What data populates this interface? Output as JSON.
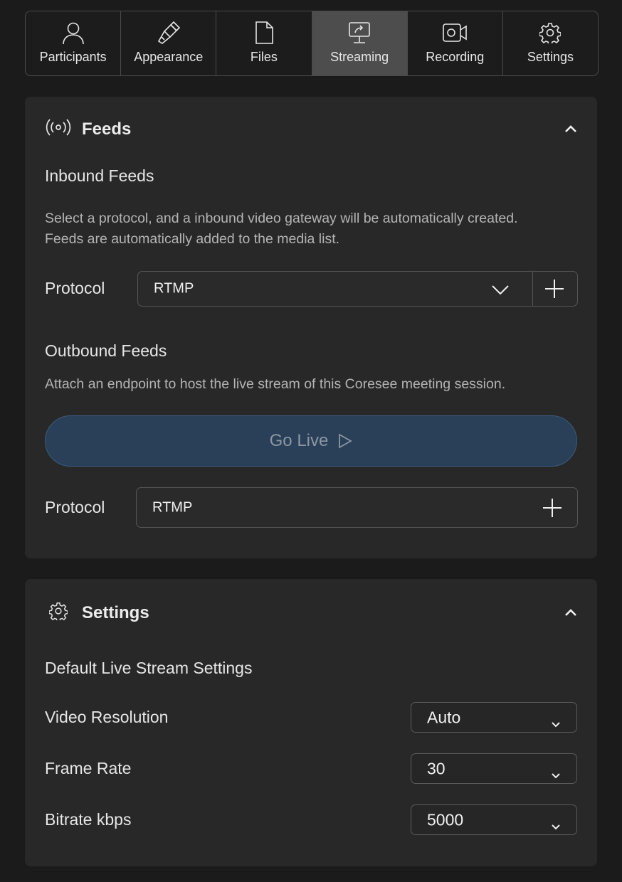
{
  "tabs": [
    {
      "label": "Participants",
      "icon": "user-icon"
    },
    {
      "label": "Appearance",
      "icon": "brush-icon"
    },
    {
      "label": "Files",
      "icon": "file-icon"
    },
    {
      "label": "Streaming",
      "icon": "screen-share-icon",
      "active": true
    },
    {
      "label": "Recording",
      "icon": "video-camera-icon"
    },
    {
      "label": "Settings",
      "icon": "gear-icon"
    }
  ],
  "feeds": {
    "title": "Feeds",
    "inbound_title": "Inbound Feeds",
    "inbound_desc_line1": "Select a protocol, and a inbound video gateway will be automatically created.",
    "inbound_desc_line2": "Feeds are automatically added to the media list.",
    "protocol_label": "Protocol",
    "inbound_protocol_value": "RTMP",
    "outbound_title": "Outbound Feeds",
    "outbound_desc": "Attach an endpoint to host the live stream of this Coresee meeting session.",
    "go_live_label": "Go Live",
    "outbound_protocol_label": "Protocol",
    "outbound_protocol_value": "RTMP"
  },
  "settings": {
    "title": "Settings",
    "section_title": "Default Live Stream Settings",
    "video_resolution_label": "Video Resolution",
    "video_resolution_value": "Auto",
    "frame_rate_label": "Frame Rate",
    "frame_rate_value": "30",
    "bitrate_label": "Bitrate kbps",
    "bitrate_value": "5000"
  },
  "colors": {
    "background": "#1b1b1b",
    "card": "#282828",
    "active_tab": "#4d4d4d",
    "go_live": "#2a4058"
  }
}
